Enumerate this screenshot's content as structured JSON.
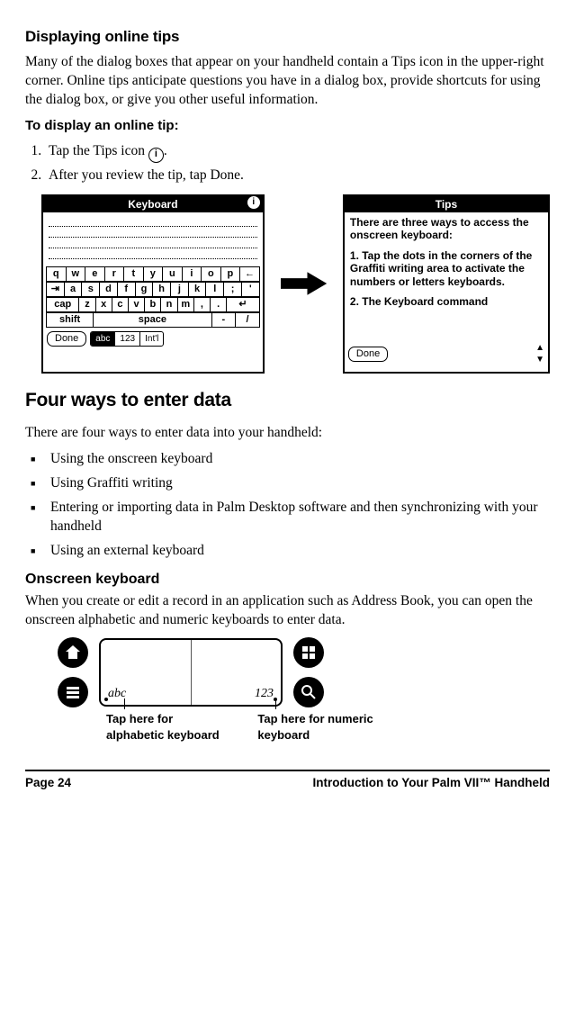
{
  "s1": {
    "title": "Displaying online tips",
    "para": "Many of the dialog boxes that appear on your handheld contain a Tips icon in the upper-right corner. Online tips anticipate questions you have in a dialog box, provide shortcuts for using the dialog box, or give you other useful information.",
    "howto": "To display an online tip:",
    "step1_a": "Tap the Tips icon ",
    "step1_b": ".",
    "step2": "After you review the tip, tap Done."
  },
  "fig1": {
    "kb_title": "Keyboard",
    "row1": [
      "q",
      "w",
      "e",
      "r",
      "t",
      "y",
      "u",
      "i",
      "o",
      "p",
      "←"
    ],
    "row2": [
      "⇥",
      "a",
      "s",
      "d",
      "f",
      "g",
      "h",
      "j",
      "k",
      "l",
      ";",
      "'"
    ],
    "row3": [
      "cap",
      "z",
      "x",
      "c",
      "v",
      "b",
      "n",
      "m",
      ",",
      ".",
      "↵"
    ],
    "row4_shift": "shift",
    "row4_space": "space",
    "row4_dash": "-",
    "row4_slash": "/",
    "done": "Done",
    "tog_abc": "abc",
    "tog_123": "123",
    "tog_intl": "Int'l"
  },
  "fig2": {
    "title": "Tips",
    "l1": "There are three ways to access the onscreen keyboard:",
    "l2": "1. Tap the dots in the corners of the Graffiti writing area to activate the numbers or letters keyboards.",
    "l3": "2. The Keyboard command",
    "done": "Done"
  },
  "s2": {
    "title": "Four ways to enter data",
    "intro": "There are four ways to enter data into your handheld:",
    "b1": "Using the onscreen keyboard",
    "b2": "Using Graffiti writing",
    "b3": "Entering or importing data in Palm Desktop software and then synchronizing with your handheld",
    "b4": "Using an external keyboard"
  },
  "s3": {
    "title": "Onscreen keyboard",
    "para": "When you create or edit a record in an application such as Address Book, you can open the onscreen alphabetic and numeric keyboards to enter data."
  },
  "labels": {
    "abc": "Tap here for alphabetic keyboard",
    "num": "Tap here for numeric keyboard"
  },
  "footer": {
    "left": "Page 24",
    "right": "Introduction to Your Palm VII™ Handheld"
  }
}
